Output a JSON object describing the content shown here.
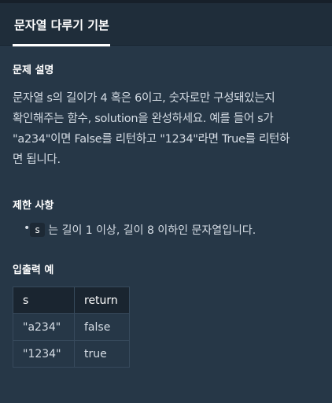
{
  "tab": {
    "label": "문자열 다루기 기본"
  },
  "problem": {
    "heading": "문제 설명",
    "lines": [
      "문자열 s의 길이가 4 혹은 6이고, 숫자로만 구성돼있는지",
      "확인해주는 함수, solution을 완성하세요. 예를 들어 s가",
      "\"a234\"이면 False를 리턴하고 \"1234\"라면 True를 리턴하",
      "면 됩니다."
    ]
  },
  "constraints": {
    "heading": "제한 사항",
    "items": [
      {
        "code": "s",
        "text": "는 길이 1 이상, 길이 8 이하인 문자열입니다."
      }
    ]
  },
  "examples": {
    "heading": "입출력 예",
    "columns": [
      "s",
      "return"
    ],
    "rows": [
      [
        "\"a234\"",
        "false"
      ],
      [
        "\"1234\"",
        "true"
      ]
    ]
  }
}
